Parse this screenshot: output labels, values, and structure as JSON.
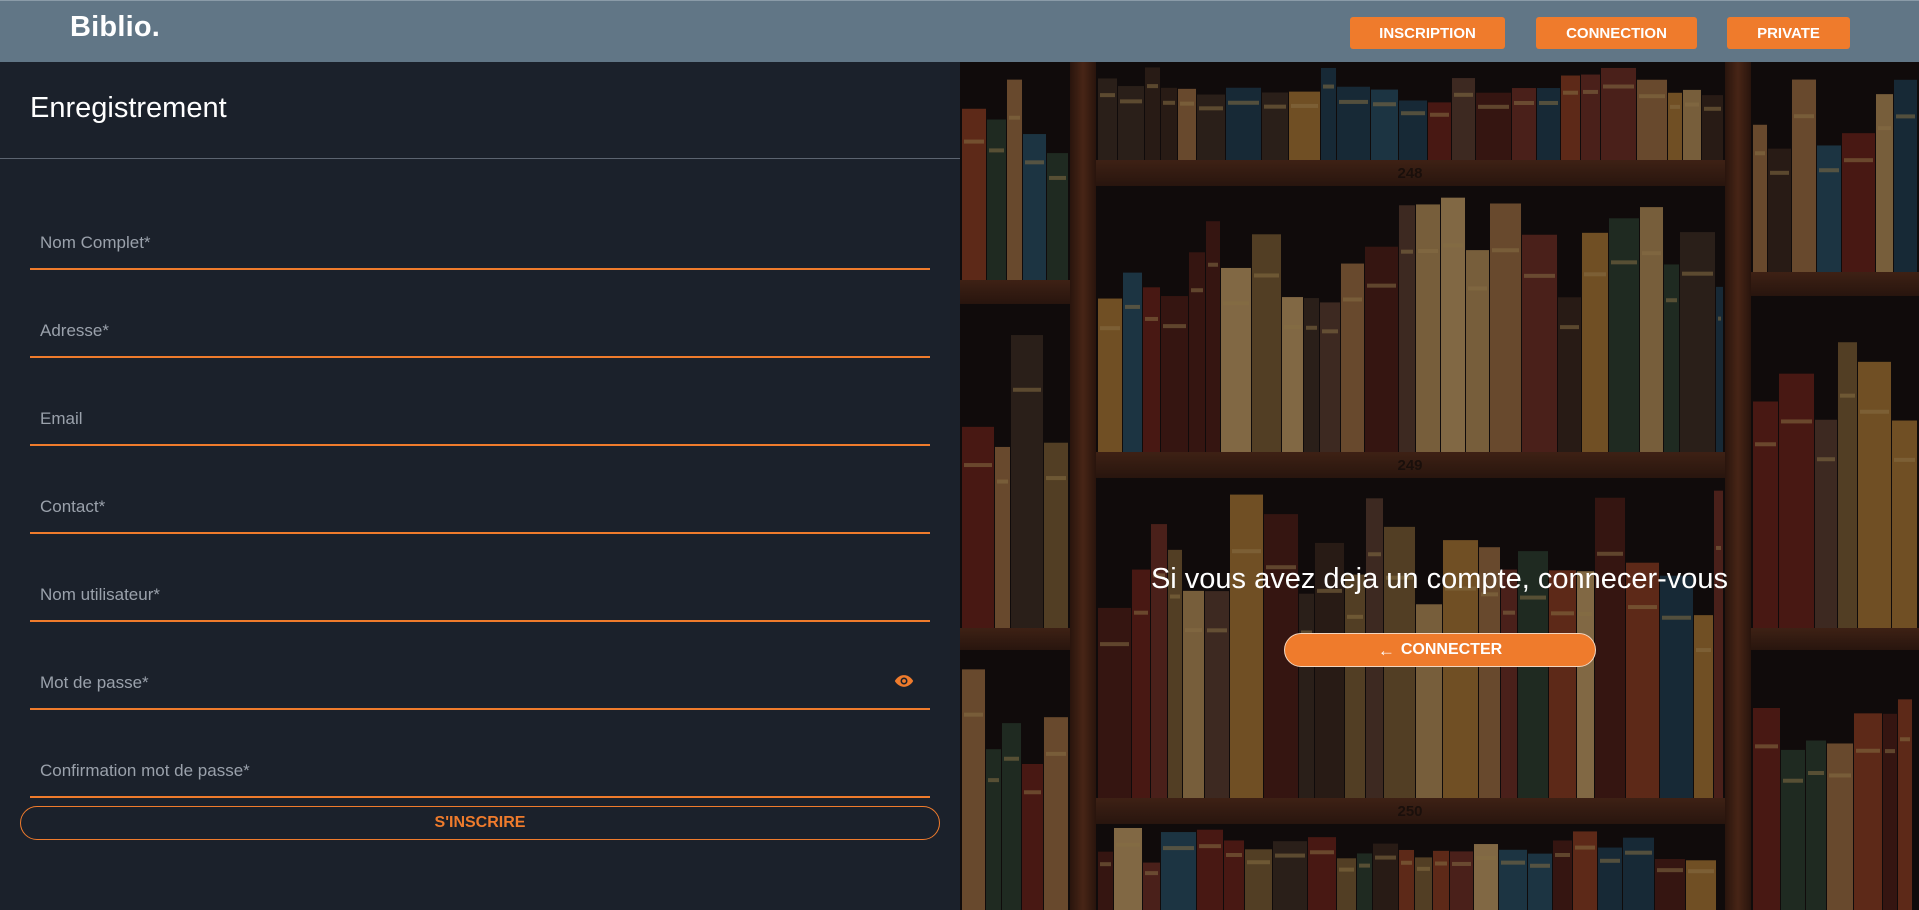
{
  "header": {
    "logo": "Biblio.",
    "nav": [
      {
        "label": "INSCRIPTION"
      },
      {
        "label": "CONNECTION"
      },
      {
        "label": "PRIVATE"
      }
    ]
  },
  "register": {
    "title": "Enregistrement",
    "fields": [
      {
        "placeholder": "Nom Complet*",
        "value": ""
      },
      {
        "placeholder": "Adresse*",
        "value": ""
      },
      {
        "placeholder": "Email",
        "value": ""
      },
      {
        "placeholder": "Contact*",
        "value": ""
      },
      {
        "placeholder": "Nom utilisateur*",
        "value": ""
      },
      {
        "placeholder": "Mot de passe*",
        "value": ""
      },
      {
        "placeholder": "Confirmation mot de passe*",
        "value": ""
      }
    ],
    "submit_label": "S'INSCRIRE"
  },
  "login_panel": {
    "message": "Si vous avez deja un compte, connecer-vous",
    "button_label": "CONNECTER",
    "button_icon": "arrow-left-icon",
    "shelf_numbers": [
      "248",
      "249",
      "250"
    ]
  },
  "colors": {
    "accent": "#ef7b2c",
    "header_bg": "#617686",
    "panel_bg": "#1b212b"
  }
}
